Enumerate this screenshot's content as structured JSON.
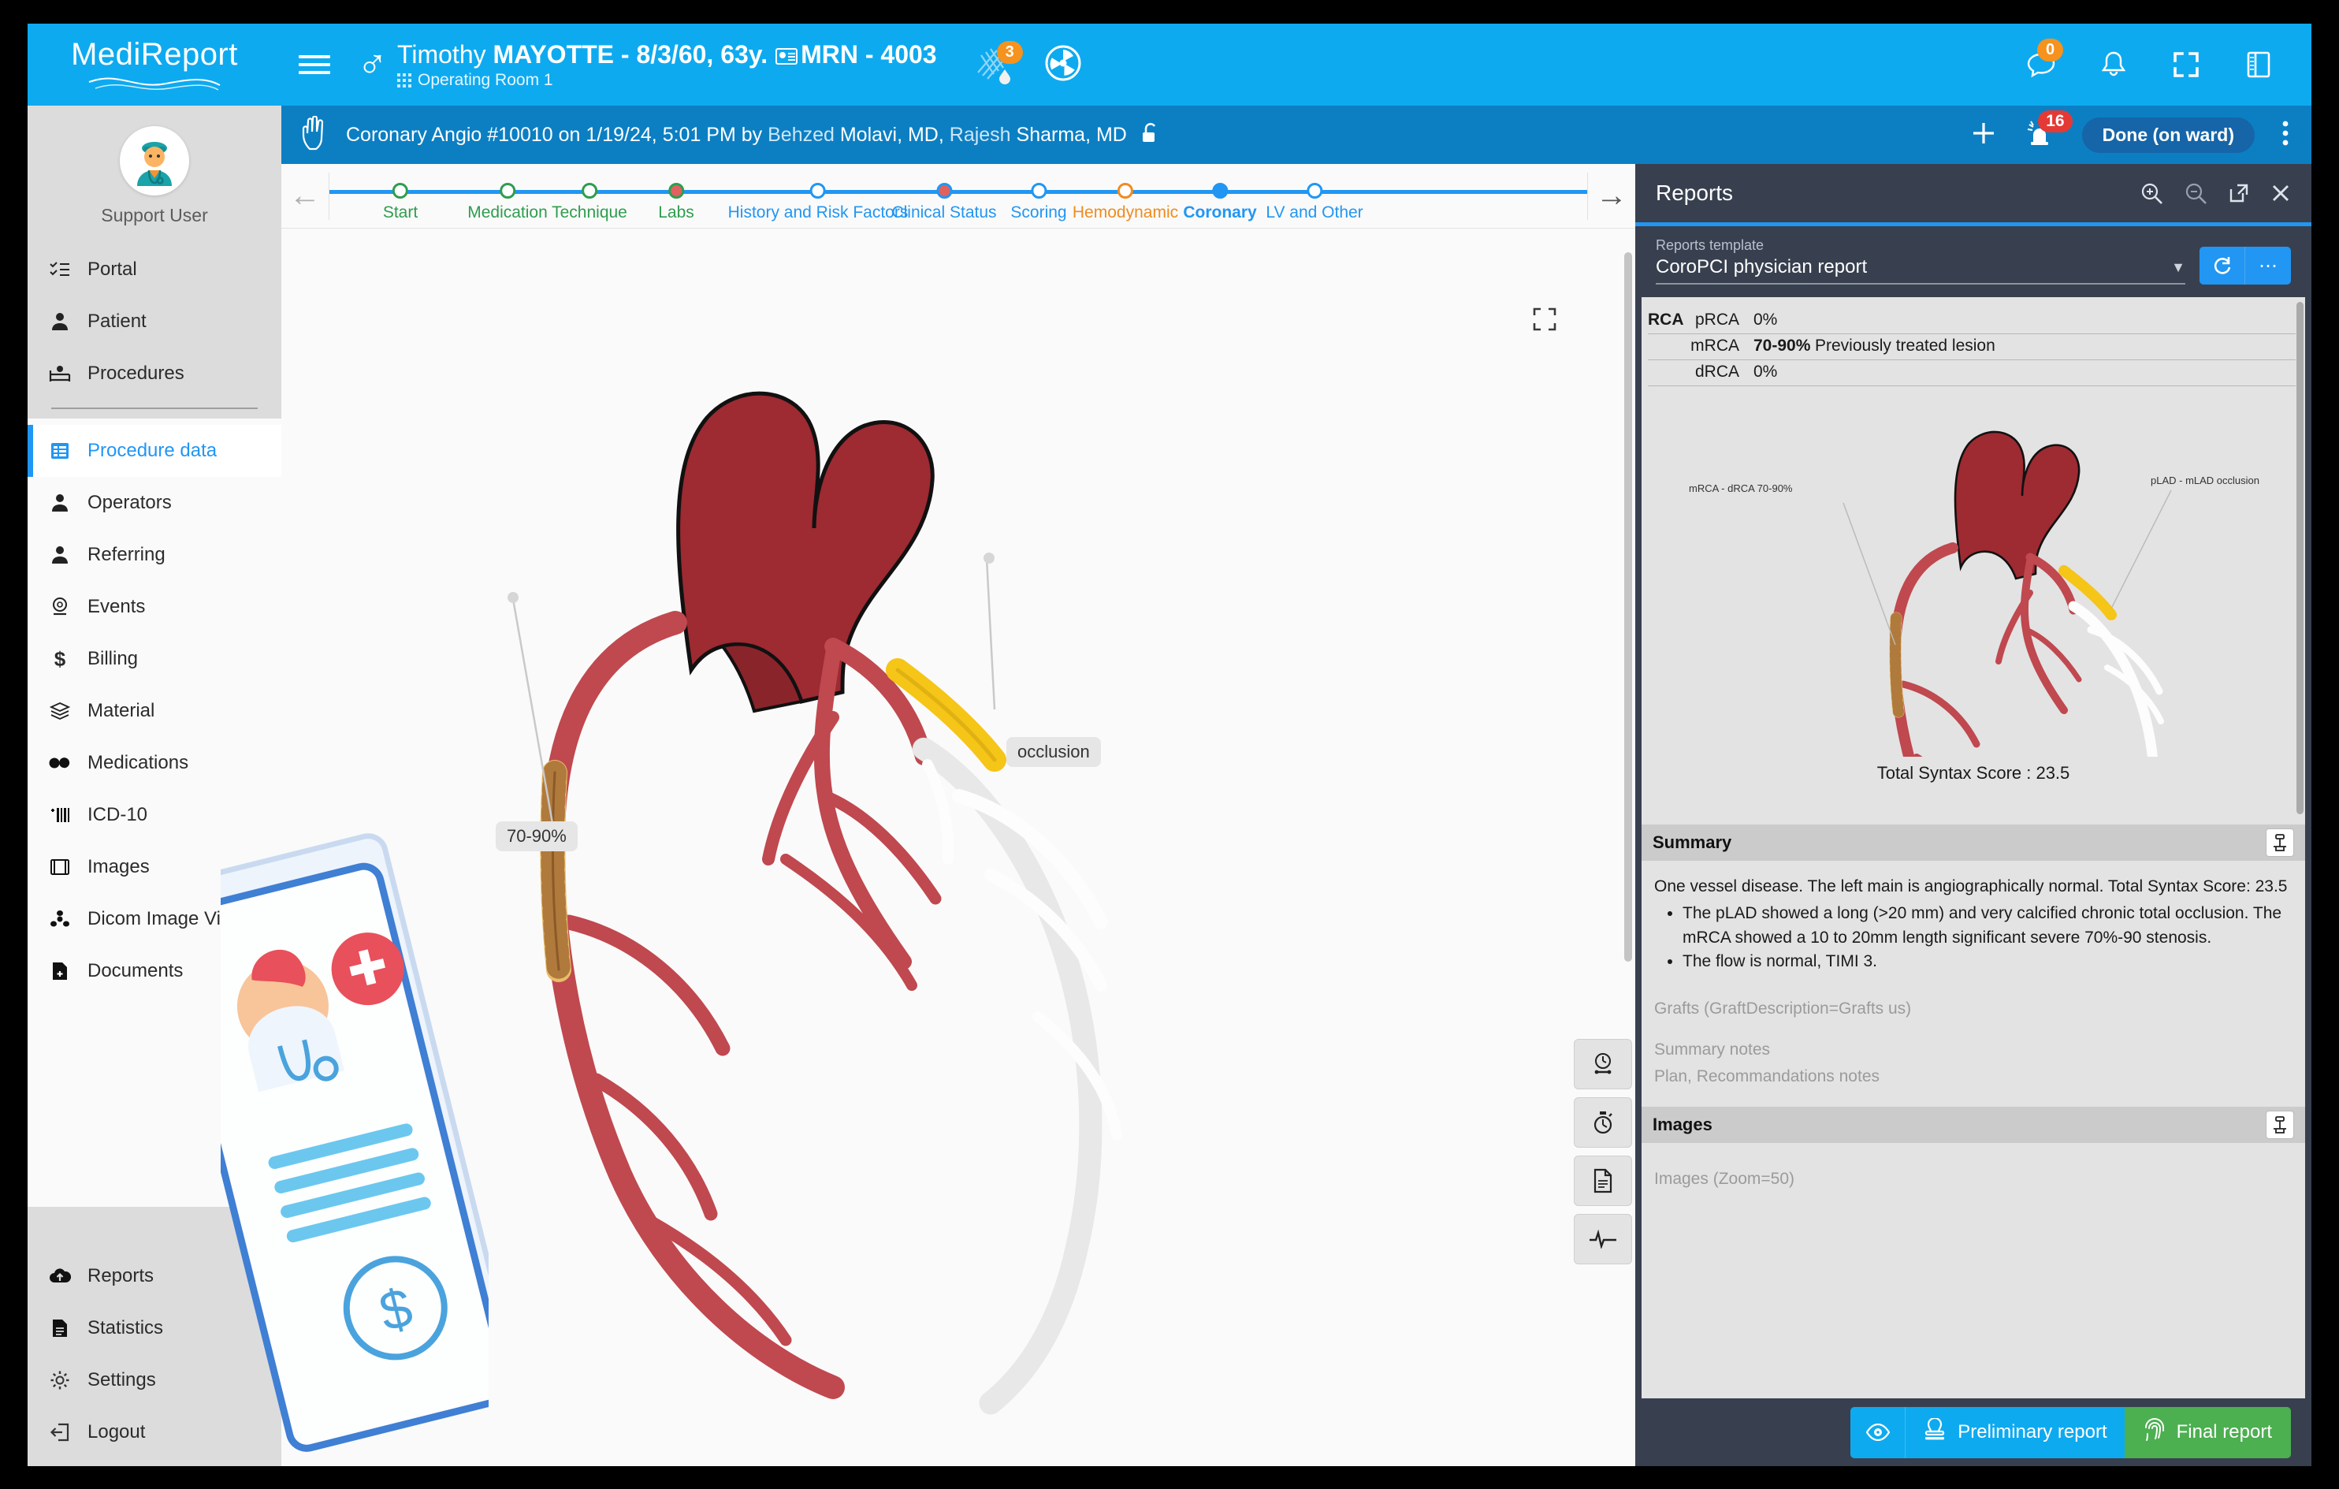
{
  "app": {
    "logo": "MediReport"
  },
  "topbar": {
    "menu_icon": "hamburger-icon",
    "gender_icon": "male-gender-icon",
    "patient_first_name": "Timothy ",
    "patient_last_name_dob": "MAYOTTE - 8/3/60, 63y.",
    "mrn": "MRN - 4003",
    "room": "Operating Room 1",
    "contrast_badge": "3",
    "radiation_icon": "radiation-icon",
    "chat_badge": "0",
    "icons": [
      "chat-icon",
      "bell-icon",
      "fullscreen-icon",
      "book-panel-icon"
    ]
  },
  "sidebar": {
    "user_name": "Support User",
    "top_items": [
      {
        "label": "Portal",
        "icon": "list-check-icon"
      },
      {
        "label": "Patient",
        "icon": "patient-icon"
      },
      {
        "label": "Procedures",
        "icon": "hospital-bed-icon"
      }
    ],
    "main_items": [
      {
        "label": "Procedure data",
        "icon": "table-data-icon",
        "active": true
      },
      {
        "label": "Operators",
        "icon": "operator-icon",
        "active": false
      },
      {
        "label": "Referring",
        "icon": "referring-doctor-icon",
        "active": false
      },
      {
        "label": "Events",
        "icon": "events-icon",
        "active": false
      },
      {
        "label": "Billing",
        "icon": "dollar-icon",
        "active": false
      },
      {
        "label": "Material",
        "icon": "layers-icon",
        "active": false
      },
      {
        "label": "Medications",
        "icon": "pills-icon",
        "active": false
      },
      {
        "label": "ICD-10",
        "icon": "icd-code-icon",
        "active": false
      },
      {
        "label": "Images",
        "icon": "film-icon",
        "active": false
      },
      {
        "label": "Dicom Image Viewer",
        "icon": "dicom-icon",
        "active": false
      },
      {
        "label": "Documents",
        "icon": "document-add-icon",
        "active": false
      }
    ],
    "bottom_items": [
      {
        "label": "Reports",
        "icon": "cloud-upload-icon"
      },
      {
        "label": "Statistics",
        "icon": "file-icon"
      },
      {
        "label": "Settings",
        "icon": "gear-icon"
      },
      {
        "label": "Logout",
        "icon": "logout-icon"
      }
    ]
  },
  "procedure_header": {
    "icon": "hand-procedure-icon",
    "title_main": "Coronary Angio #10010 on 1/19/24, 5:01 PM by ",
    "operator_1": "Behzed",
    "operator_1_rest": " Molavi, MD, ",
    "operator_2": "Rajesh",
    "operator_2_rest": " Sharma, MD",
    "lock_icon": "unlock-icon",
    "add_icon": "plus-icon",
    "alarm_icon": "alarm-icon",
    "alarm_badge": "16",
    "status_button": "Done (on ward)",
    "more_icon": "kebab-menu-icon"
  },
  "stepper": {
    "back_icon": "arrow-left-icon",
    "forward_icon": "arrow-right-icon",
    "steps": [
      {
        "label": "Start",
        "state": "done"
      },
      {
        "label": "Medication",
        "state": "done"
      },
      {
        "label": "Technique",
        "state": "done"
      },
      {
        "label": "Labs",
        "state": "done-filled"
      },
      {
        "label": "History and Risk Factors",
        "state": "todo"
      },
      {
        "label": "Clinical Status",
        "state": "todo-filled"
      },
      {
        "label": "Scoring",
        "state": "todo"
      },
      {
        "label": "Hemodynamic",
        "state": "warn"
      },
      {
        "label": "Coronary",
        "state": "current"
      },
      {
        "label": "LV and Other",
        "state": "todo"
      }
    ]
  },
  "diagram": {
    "annotation_left": "70-90%",
    "annotation_right": "occlusion",
    "expand_icon": "expand-icon",
    "tools": [
      {
        "icon": "pressure-gauge-icon"
      },
      {
        "icon": "stopwatch-icon"
      },
      {
        "icon": "document-icon"
      },
      {
        "icon": "ecg-waveform-icon"
      }
    ]
  },
  "reports": {
    "title": "Reports",
    "head_icons": [
      "zoom-in-icon",
      "zoom-out-icon",
      "open-external-icon",
      "close-icon"
    ],
    "template_label": "Reports template",
    "template_value": "CoroPCI physician report",
    "refresh_icon": "refresh-icon",
    "more_icon": "ellipsis-icon",
    "rca_group": "RCA",
    "rca_rows": [
      {
        "segment": "pRCA",
        "value": "0%",
        "note": ""
      },
      {
        "segment": "mRCA",
        "value": "70-90%",
        "note": "Previously treated lesion"
      },
      {
        "segment": "dRCA",
        "value": "0%",
        "note": ""
      }
    ],
    "diagram_label_left": "mRCA - dRCA 70-90%",
    "diagram_label_right": "pLAD - mLAD occlusion",
    "syntax_score": "Total Syntax Score : 23.5",
    "summary_heading": "Summary",
    "summary_copy_icon": "copy-icon",
    "summary_intro": "One vessel disease. The left main is angiographically normal. Total Syntax Score: 23.5",
    "summary_bullets": [
      "The pLAD showed a long (>20 mm) and very calcified chronic total occlusion. The mRCA showed a 10 to 20mm length significant severe 70%-90 stenosis.",
      "The flow is normal, TIMI 3."
    ],
    "placeholder_grafts": "Grafts (GraftDescription=Grafts us)",
    "placeholder_summary_notes": "Summary notes",
    "placeholder_plan": "Plan, Recommandations notes",
    "images_heading": "Images",
    "images_copy_icon": "copy-icon",
    "placeholder_images": "Images (Zoom=50)",
    "eye_icon": "eye-icon",
    "preliminary_icon": "stamp-icon",
    "preliminary_label": "Preliminary report",
    "final_icon": "fingerprint-icon",
    "final_label": "Final report"
  },
  "colors": {
    "brand_blue": "#0eaaf0",
    "header_blue": "#0c7fc3",
    "accent_blue": "#2196f3",
    "done_green": "#2e9d4f",
    "warn_orange": "#ef8c20",
    "final_green": "#4caf50",
    "panel_dark": "#38404f",
    "artery_red": "#c0484f",
    "aorta_red": "#a02b32",
    "lesion_yellow": "#f5c518"
  }
}
